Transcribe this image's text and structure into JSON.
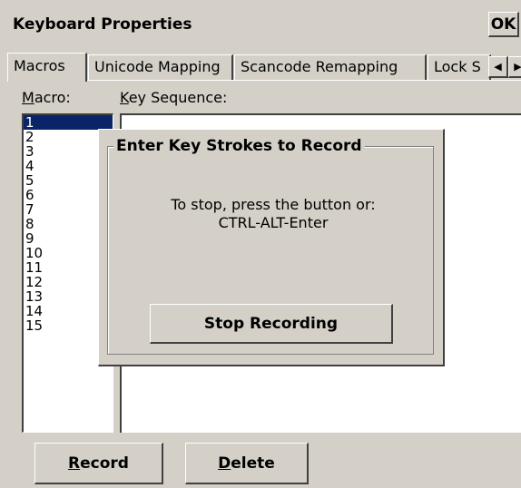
{
  "window": {
    "title": "Keyboard Properties",
    "ok_label": "OK",
    "close_label": "×"
  },
  "tabs": [
    {
      "label": "Macros",
      "active": true
    },
    {
      "label": "Unicode Mapping",
      "active": false
    },
    {
      "label": "Scancode Remapping",
      "active": false
    },
    {
      "label": "Lock S",
      "active": false
    }
  ],
  "tab_scroll": {
    "left": "◀",
    "right": "▶"
  },
  "macro_label": {
    "mnemonic": "M",
    "rest": "acro:"
  },
  "key_sequence_label": {
    "mnemonic": "K",
    "rest": "ey Sequence:"
  },
  "macros": [
    "1",
    "2",
    "3",
    "4",
    "5",
    "6",
    "7",
    "8",
    "9",
    "10",
    "11",
    "12",
    "13",
    "14",
    "15"
  ],
  "selected_macro": "1",
  "dialog": {
    "title": "Enter Key Strokes to Record",
    "message_line1": "To stop, press the button or:",
    "message_line2": "CTRL-ALT-Enter",
    "stop_button": "Stop Recording"
  },
  "buttons": {
    "record": {
      "mnemonic": "R",
      "rest": "ecord"
    },
    "delete": {
      "mnemonic": "D",
      "rest": "elete"
    }
  },
  "colors": {
    "face": "#d4d0c8",
    "selection": "#0a246a",
    "shadow": "#404040"
  }
}
